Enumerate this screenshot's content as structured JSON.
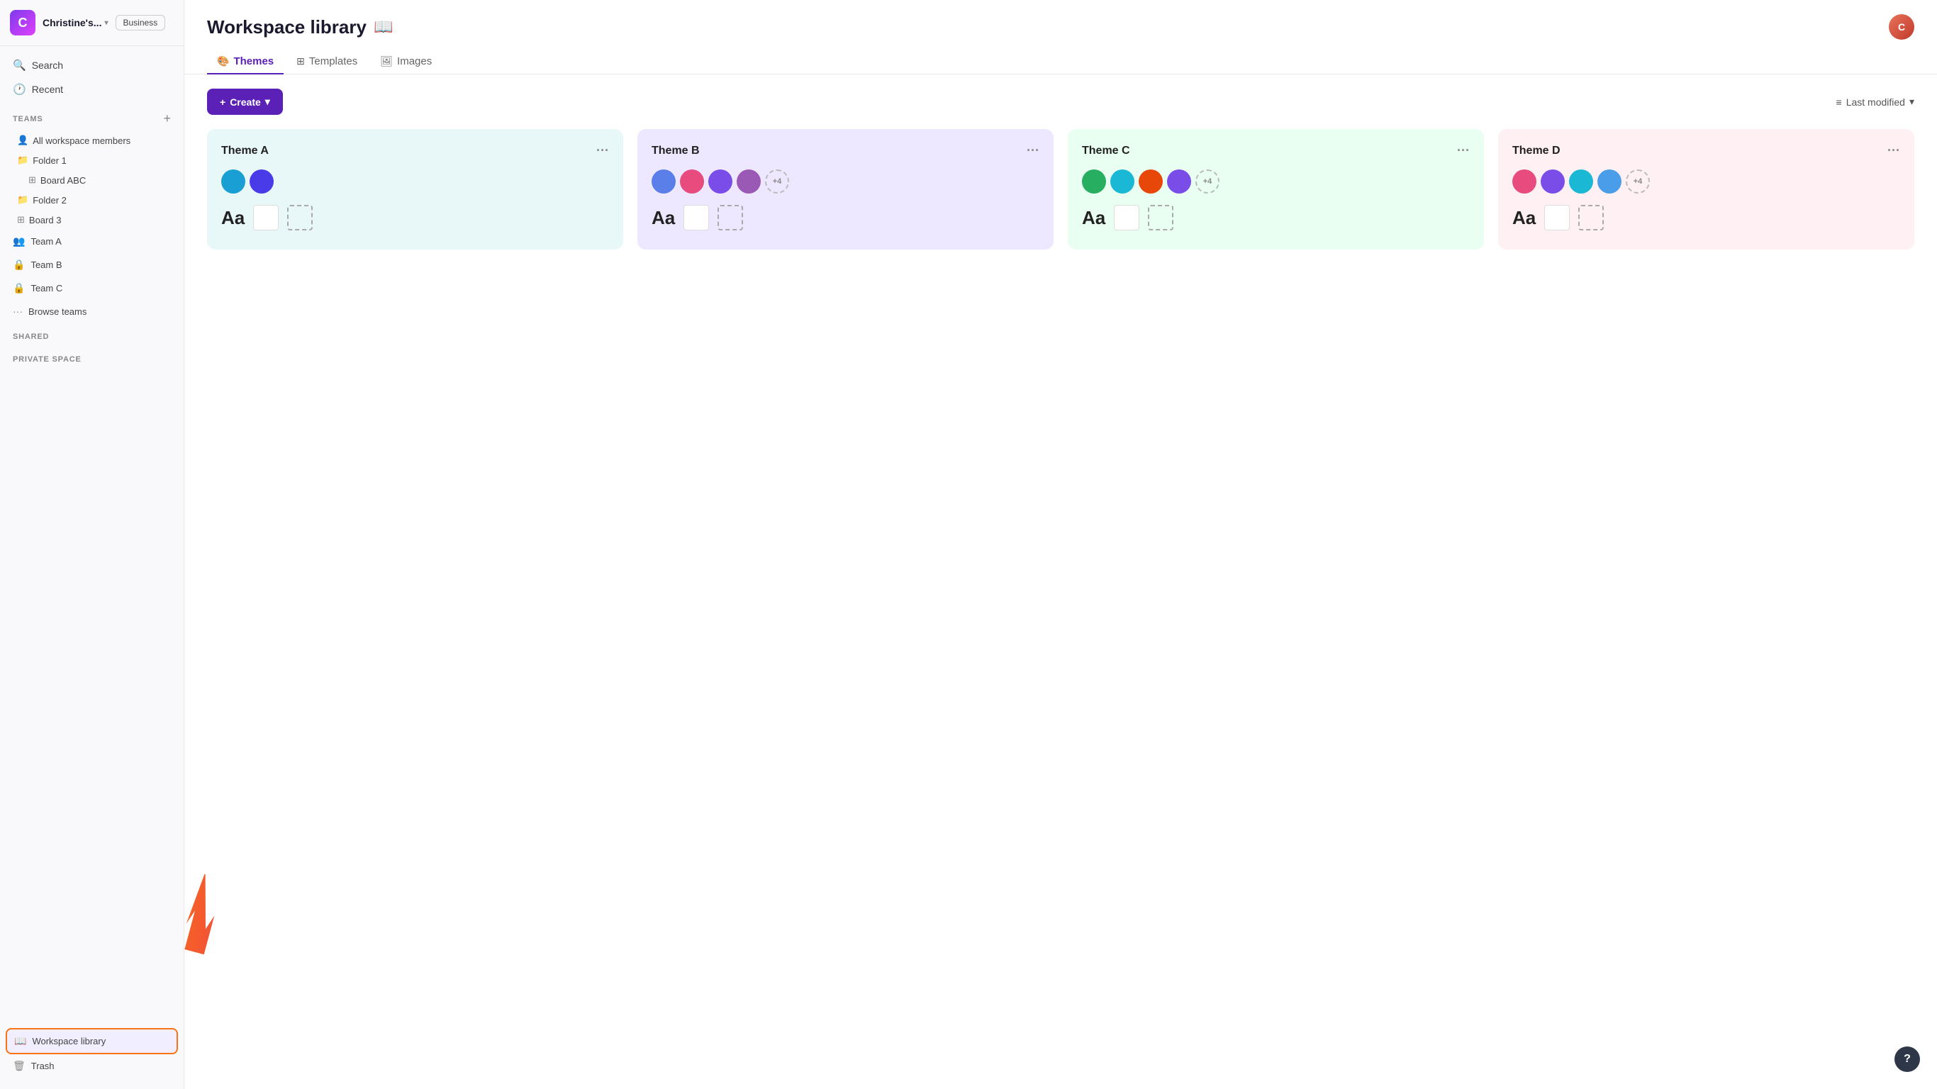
{
  "app": {
    "logo_letter": "C",
    "workspace_name": "Christine's...",
    "plan_badge": "Business"
  },
  "sidebar": {
    "search_label": "Search",
    "recent_label": "Recent",
    "teams_section": "TEAMS",
    "all_workspace_members": "All workspace members",
    "folder1": "Folder 1",
    "board_abc": "Board ABC",
    "folder2": "Folder 2",
    "board3": "Board 3",
    "team_a": "Team A",
    "team_b": "Team B",
    "team_c": "Team C",
    "browse_teams": "Browse teams",
    "shared_section": "SHARED",
    "private_section": "PRIVATE SPACE",
    "workspace_library": "Workspace library",
    "trash": "Trash"
  },
  "header": {
    "title": "Workspace library",
    "avatar_initials": "C"
  },
  "tabs": [
    {
      "id": "themes",
      "label": "Themes",
      "active": true
    },
    {
      "id": "templates",
      "label": "Templates",
      "active": false
    },
    {
      "id": "images",
      "label": "Images",
      "active": false
    }
  ],
  "toolbar": {
    "create_label": "Create",
    "sort_label": "Last modified"
  },
  "themes": [
    {
      "name": "Theme A",
      "bg_color": "#e8f7f7",
      "colors": [
        "#1a9fd4",
        "#4a3be8"
      ],
      "extra_count": null
    },
    {
      "name": "Theme B",
      "bg_color": "#ede8ff",
      "colors": [
        "#5a7fe8",
        "#e84c7f",
        "#7b4de8",
        "#9b59b6",
        "#e8873a"
      ],
      "extra_count": "+4"
    },
    {
      "name": "Theme C",
      "bg_color": "#e8fff2",
      "colors": [
        "#27ae60",
        "#1ab8d4",
        "#e8470a",
        "#7b4de8",
        "#1a6ad4"
      ],
      "extra_count": "+4"
    },
    {
      "name": "Theme D",
      "bg_color": "#fff0f3",
      "colors": [
        "#e84c7f",
        "#7b4de8",
        "#1ab8d4",
        "#4a9de8",
        "#e8a030"
      ],
      "extra_count": "+4"
    }
  ],
  "help_label": "?"
}
